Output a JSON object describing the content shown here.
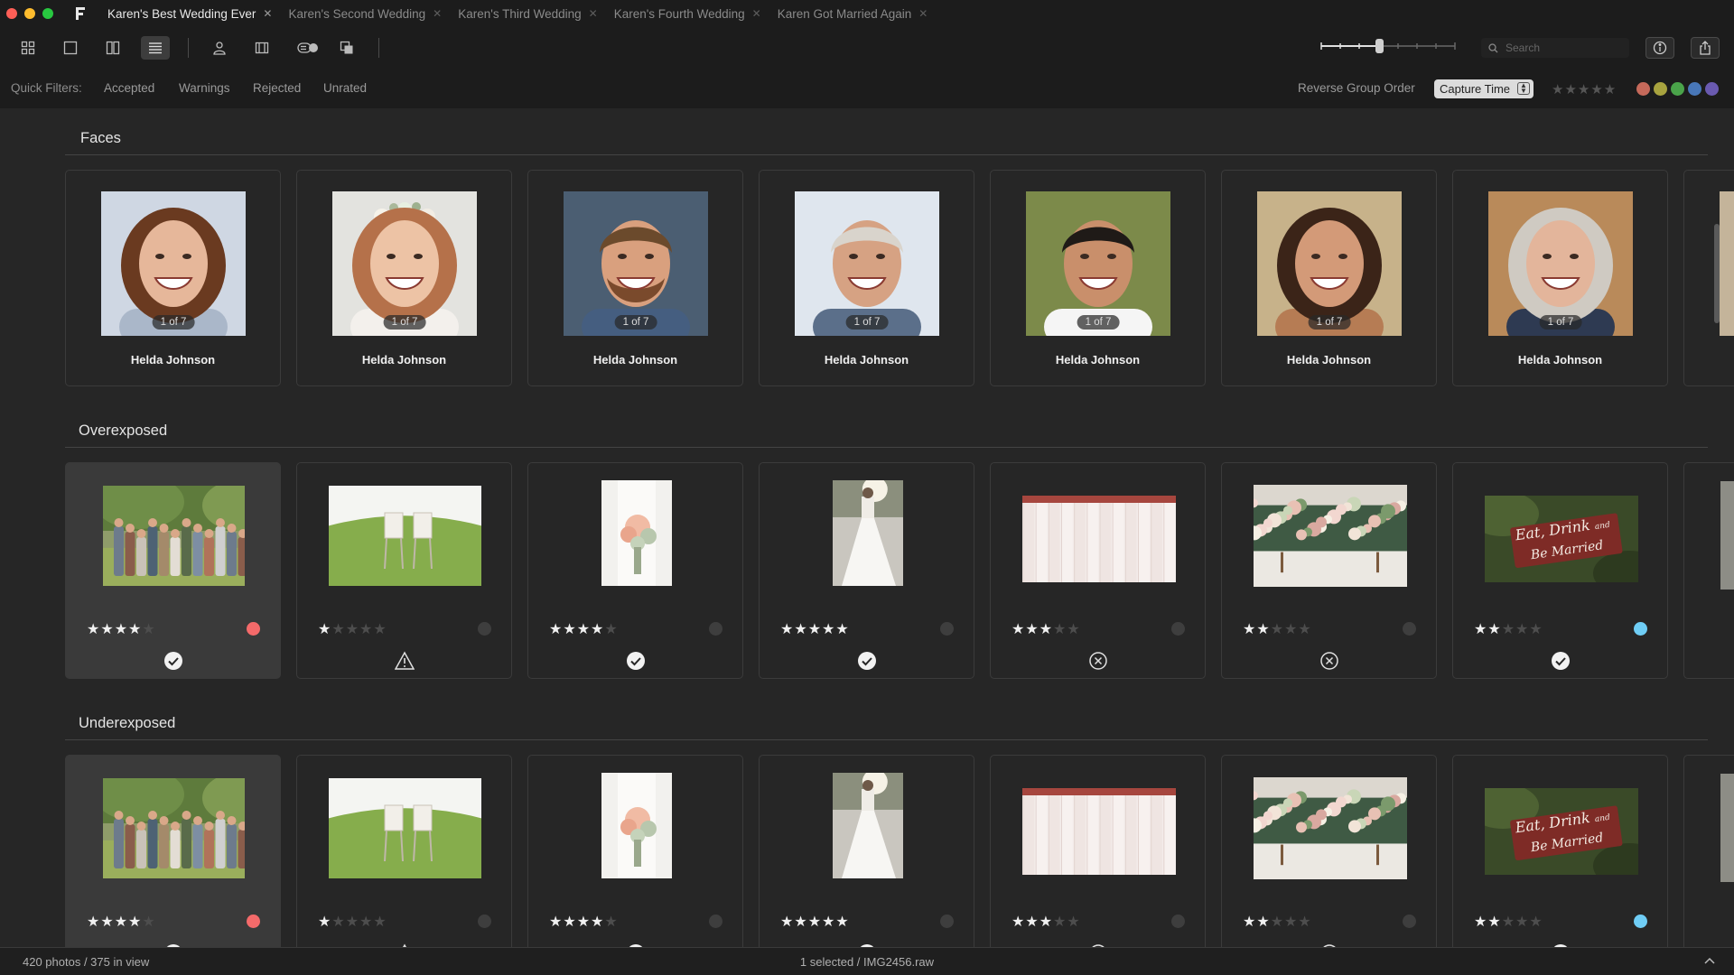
{
  "colors": {
    "traffic_red": "#fe5f57",
    "traffic_yellow": "#febc2e",
    "traffic_green": "#28c840",
    "label_red": "#f46a6a",
    "label_blue": "#6fcdf5"
  },
  "tabs": [
    {
      "label": "Karen's Best Wedding Ever",
      "active": true
    },
    {
      "label": "Karen's Second Wedding"
    },
    {
      "label": "Karen's Third Wedding"
    },
    {
      "label": "Karen's Fourth Wedding"
    },
    {
      "label": "Karen Got Married Again"
    }
  ],
  "toolbar": {
    "icons": [
      "grid-view-icon",
      "single-view-icon",
      "compare-view-icon",
      "list-view-icon",
      "person-icon",
      "panel-icon",
      "stack-badge-icon",
      "duplicates-icon"
    ],
    "search_placeholder": "Search",
    "info_icon": "info-icon",
    "share_icon": "share-icon"
  },
  "filters": {
    "label": "Quick Filters:",
    "items": [
      "Accepted",
      "Warnings",
      "Rejected",
      "Unrated"
    ],
    "reverse": "Reverse Group Order",
    "sort": "Capture Time",
    "label_colors": [
      "#c5695a",
      "#a8a33f",
      "#4aa34a",
      "#4877b8",
      "#6a5ab0"
    ]
  },
  "faces": {
    "title": "Faces",
    "people": [
      {
        "name": "Helda Johnson",
        "badge": "1 of 7"
      },
      {
        "name": "Helda Johnson",
        "badge": "1 of 7"
      },
      {
        "name": "Helda Johnson",
        "badge": "1 of 7"
      },
      {
        "name": "Helda Johnson",
        "badge": "1 of 7"
      },
      {
        "name": "Helda Johnson",
        "badge": "1 of 7"
      },
      {
        "name": "Helda Johnson",
        "badge": "1 of 7"
      },
      {
        "name": "Helda Johnson",
        "badge": "1 of 7"
      }
    ]
  },
  "groups": [
    {
      "title": "Overexposed",
      "photos": [
        {
          "subject": "group-photo",
          "stars": 4,
          "dot": "red",
          "status": "accepted",
          "selected": true
        },
        {
          "subject": "chairs-on-lawn",
          "stars": 1,
          "dot": "none",
          "status": "warning"
        },
        {
          "subject": "bridal-bouquet",
          "stars": 4,
          "dot": "none",
          "status": "accepted"
        },
        {
          "subject": "bride-dress",
          "stars": 5,
          "dot": "none",
          "status": "accepted"
        },
        {
          "subject": "dress-rack",
          "stars": 3,
          "dot": "none",
          "status": "rejected"
        },
        {
          "subject": "flower-arrangement",
          "stars": 2,
          "dot": "none",
          "status": "rejected"
        },
        {
          "subject": "eat-drink-sign",
          "stars": 2,
          "dot": "blue",
          "status": "accepted"
        }
      ]
    },
    {
      "title": "Underexposed",
      "photos": [
        {
          "subject": "group-photo",
          "stars": 4,
          "dot": "red",
          "status": "accepted",
          "selected": true
        },
        {
          "subject": "chairs-on-lawn",
          "stars": 1,
          "dot": "none",
          "status": "warning"
        },
        {
          "subject": "bridal-bouquet",
          "stars": 4,
          "dot": "none",
          "status": "accepted"
        },
        {
          "subject": "bride-dress",
          "stars": 5,
          "dot": "none",
          "status": "accepted"
        },
        {
          "subject": "dress-rack",
          "stars": 3,
          "dot": "none",
          "status": "rejected"
        },
        {
          "subject": "flower-arrangement",
          "stars": 2,
          "dot": "none",
          "status": "rejected"
        },
        {
          "subject": "eat-drink-sign",
          "stars": 2,
          "dot": "blue",
          "status": "accepted"
        }
      ]
    }
  ],
  "sign_text": {
    "line1": "Eat, Drink",
    "small": "and",
    "line2": "Be Married"
  },
  "status": {
    "count": "420 photos / 375 in view",
    "selected": "1 selected / IMG2456.raw"
  }
}
